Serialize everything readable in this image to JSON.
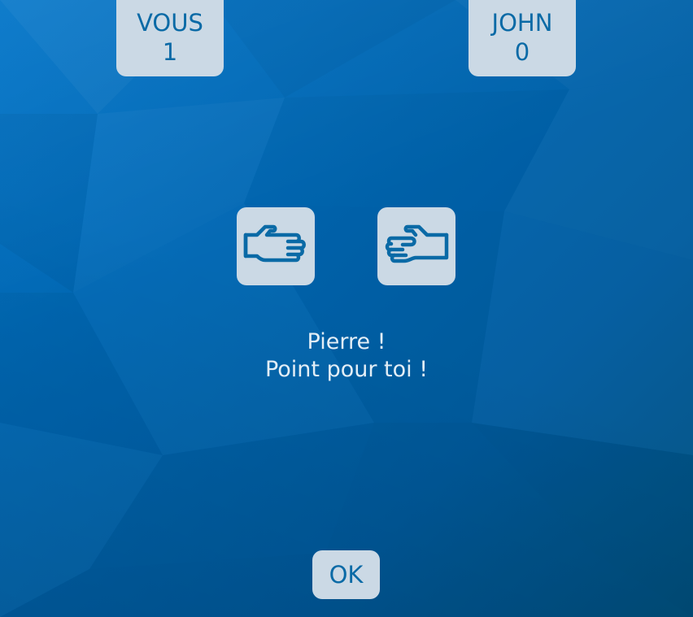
{
  "scoreboard": {
    "player": {
      "name": "VOUS",
      "score": "1"
    },
    "opponent": {
      "name": "JOHN",
      "score": "0"
    }
  },
  "hands": {
    "player": {
      "icon": "hand-scissors-icon"
    },
    "opponent": {
      "icon": "hand-rock-icon"
    }
  },
  "result": {
    "line1": "Pierre !",
    "line2": "Point pour toi !"
  },
  "ok_label": "OK",
  "colors": {
    "background": "#0067b3",
    "card": "#cbd9e5",
    "card_text": "#0a6aa6",
    "message_text": "#e3eef6"
  }
}
